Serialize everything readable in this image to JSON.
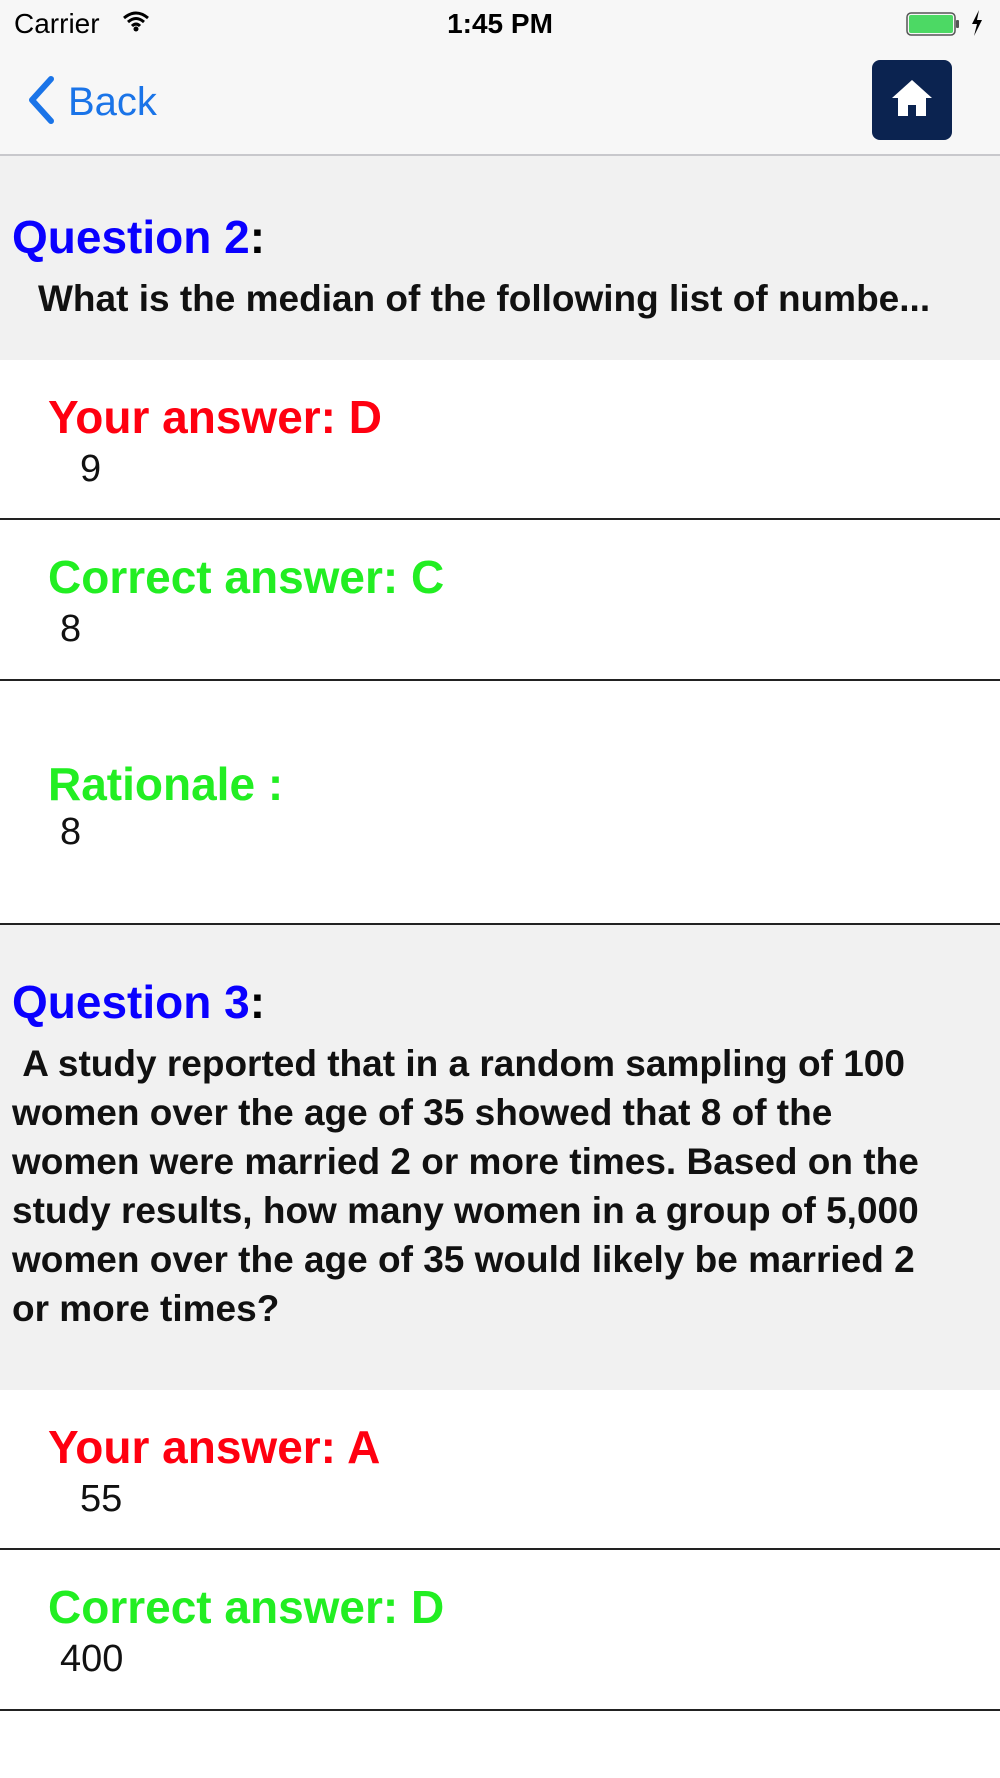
{
  "status_bar": {
    "carrier": "Carrier",
    "time": "1:45 PM",
    "battery_color": "#4cd964"
  },
  "nav": {
    "back_label": "Back",
    "home_icon": "home-icon",
    "home_bg": "#0b2350"
  },
  "questions": [
    {
      "title": "Question 2",
      "colon": ":",
      "text": "What is the median of the following list of numbe...",
      "your_answer_label": "Your answer: D",
      "your_answer_value": "9",
      "correct_answer_label": "Correct answer: C",
      "correct_answer_value": "8",
      "rationale_label": "Rationale :",
      "rationale_value": "8"
    },
    {
      "title": "Question 3",
      "colon": ":",
      "text": " A study reported that in a random sampling of 100\nwomen over the age of 35 showed that 8 of the\nwomen were married 2 or more times. Based on the\nstudy results, how many women in a group of 5,000\nwomen over the age of 35 would likely be married 2\nor more times?",
      "your_answer_label": "Your answer: A",
      "your_answer_value": "55",
      "correct_answer_label": "Correct answer: D",
      "correct_answer_value": "400"
    }
  ],
  "colors": {
    "question_title": "#0a00ff",
    "wrong": "#ff0010",
    "correct": "#22ee22"
  }
}
